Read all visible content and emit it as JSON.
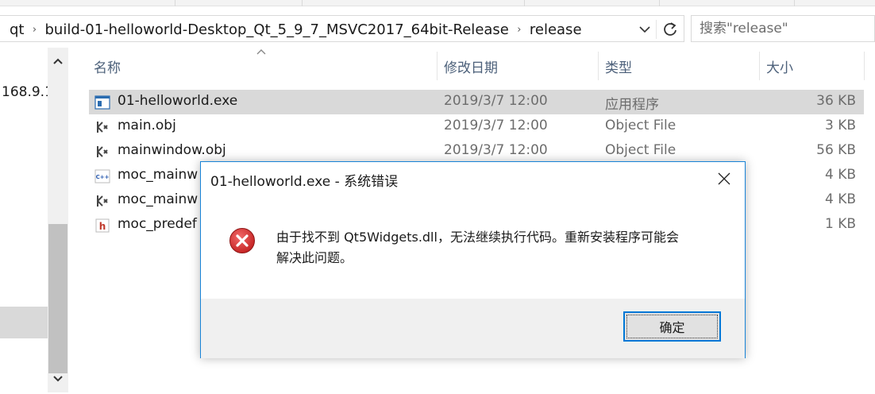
{
  "address": {
    "crumbs": [
      "qt",
      "build-01-helloworld-Desktop_Qt_5_9_7_MSVC2017_64bit-Release",
      "release"
    ],
    "separator": "›"
  },
  "search": {
    "placeholder": "搜索\"release\""
  },
  "nav": {
    "visible_text": "168.9.1"
  },
  "columns": {
    "name": "名称",
    "date": "修改日期",
    "type": "类型",
    "size": "大小"
  },
  "files": [
    {
      "name": "01-helloworld.exe",
      "date": "2019/3/7 12:00",
      "type": "应用程序",
      "size": "36 KB",
      "icon": "exe-icon",
      "selected": true
    },
    {
      "name": "main.obj",
      "date": "2019/3/7 12:00",
      "type": "Object File",
      "size": "3 KB",
      "icon": "obj-file-icon",
      "selected": false
    },
    {
      "name": "mainwindow.obj",
      "date": "2019/3/7 12:00",
      "type": "Object File",
      "size": "56 KB",
      "icon": "obj-file-icon",
      "selected": false
    },
    {
      "name": "moc_mainw",
      "date": "",
      "type": "",
      "size": "4 KB",
      "icon": "cpp-file-icon",
      "selected": false
    },
    {
      "name": "moc_mainw",
      "date": "",
      "type": "",
      "size": "4 KB",
      "icon": "obj-file-icon",
      "selected": false
    },
    {
      "name": "moc_predef",
      "date": "",
      "type": "",
      "size": "1 KB",
      "icon": "header-file-icon",
      "selected": false
    }
  ],
  "dialog": {
    "title": "01-helloworld.exe - 系统错误",
    "message_line1": "由于找不到 Qt5Widgets.dll，无法继续执行代码。重新安装程序可能会",
    "message_line2": "解决此问题。",
    "ok_label": "确定",
    "icon": "error-icon"
  },
  "colors": {
    "accent": "#0078d7",
    "dialog_border": "#1883d7",
    "selection": "#d9d9d9",
    "error_red": "#d32f2f",
    "header_text": "#4c607a"
  }
}
